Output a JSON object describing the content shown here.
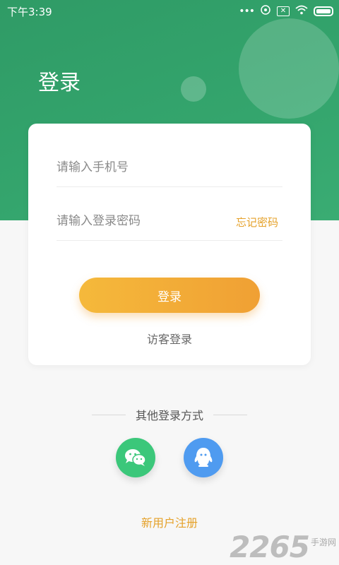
{
  "status_bar": {
    "time": "下午3:39",
    "icons": [
      "dots-icon",
      "hotspot-icon",
      "sim-x-icon",
      "wifi-icon",
      "battery-icon"
    ]
  },
  "header": {
    "title": "登录"
  },
  "form": {
    "phone_placeholder": "请输入手机号",
    "phone_value": "",
    "password_placeholder": "请输入登录密码",
    "password_value": "",
    "forgot_label": "忘记密码",
    "login_label": "登录",
    "guest_label": "访客登录"
  },
  "other_login": {
    "title": "其他登录方式",
    "providers": [
      "wechat-icon",
      "qq-icon"
    ]
  },
  "register_label": "新用户注册",
  "watermark": {
    "number": "2265",
    "text": "手游网"
  },
  "colors": {
    "header_green": "#34a56d",
    "accent_orange": "#f0a034",
    "link_orange": "#e5a129",
    "wechat_green": "#3bc77a",
    "qq_blue": "#4f9bf0"
  }
}
